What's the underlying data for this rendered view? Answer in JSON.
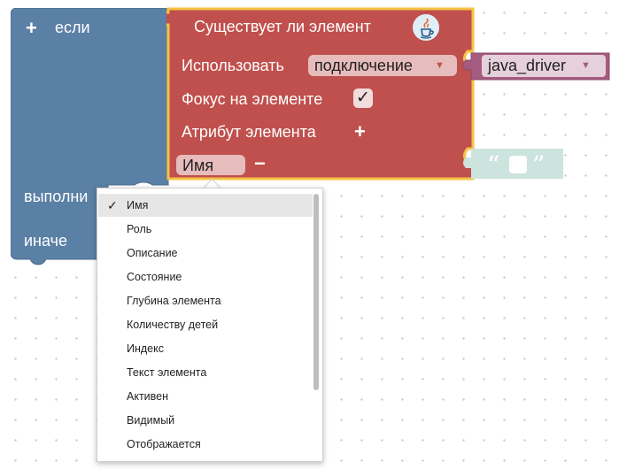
{
  "if_block": {
    "plus": "+",
    "if_label": "если",
    "do_label": "выполни",
    "else_label": "иначе"
  },
  "main_block": {
    "title": "Существует ли элемент",
    "use_label": "Использовать",
    "connection_value": "подключение",
    "focus_label": "Фокус на элементе",
    "focus_checked": "✓",
    "attribute_label": "Атрибут элемента",
    "attribute_plus": "+",
    "attribute_value": "Имя",
    "attribute_minus": "−"
  },
  "java_driver": {
    "value": "java_driver"
  },
  "text_block": {
    "open_quote": "“",
    "close_quote": "”"
  },
  "dropdown": {
    "check_mark": "✓",
    "selected_index": 0,
    "items": [
      "Имя",
      "Роль",
      "Описание",
      "Состояние",
      "Глубина элемента",
      "Количеству детей",
      "Индекс",
      "Текст элемента",
      "Активен",
      "Видимый",
      "Отображается"
    ]
  },
  "colors": {
    "if_block": "#5b80a5",
    "main_block": "#c0504d",
    "main_border": "#f5c242",
    "java_block": "#a55b80",
    "text_block": "#cde3dd"
  }
}
